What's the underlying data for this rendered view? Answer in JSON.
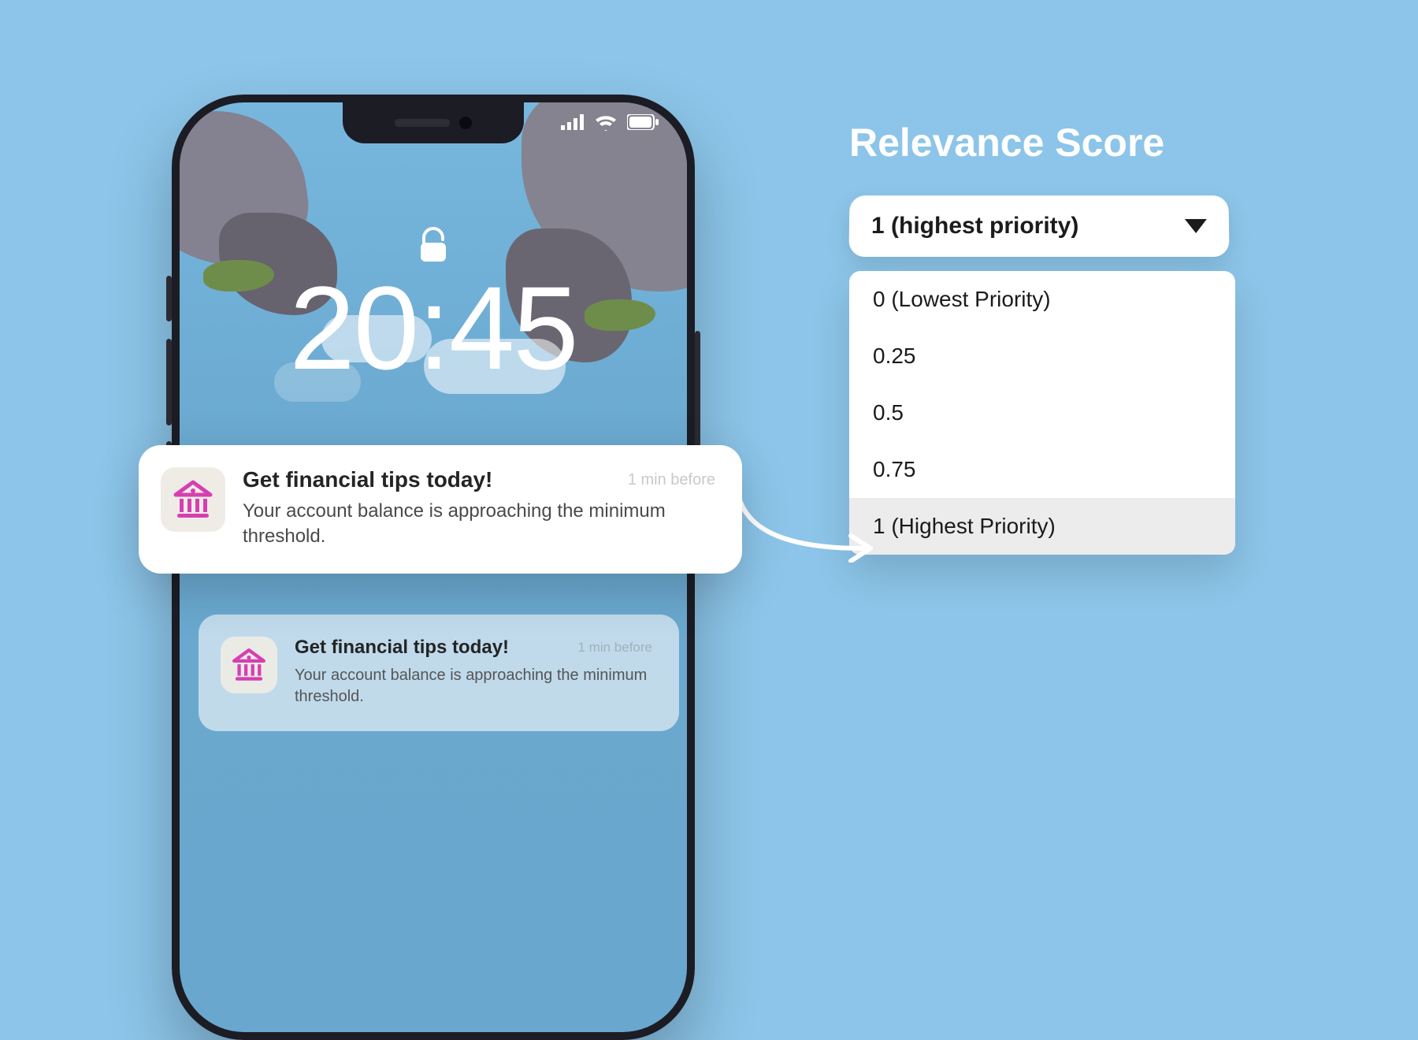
{
  "phone": {
    "clock": "20:45",
    "notification": {
      "title": "Get financial tips today!",
      "body": "Your account balance is approaching the minimum threshold.",
      "timestamp": "1 min before"
    },
    "notification_secondary": {
      "title": "Get financial tips today!",
      "body": "Your account balance is approaching the minimum threshold.",
      "timestamp": "1 min before"
    }
  },
  "panel": {
    "title": "Relevance Score",
    "selected": "1 (highest priority)",
    "options": {
      "o0": "0 (Lowest Priority)",
      "o1": "0.25",
      "o2": "0.5",
      "o3": "0.75",
      "o4": "1 (Highest Priority)"
    }
  }
}
